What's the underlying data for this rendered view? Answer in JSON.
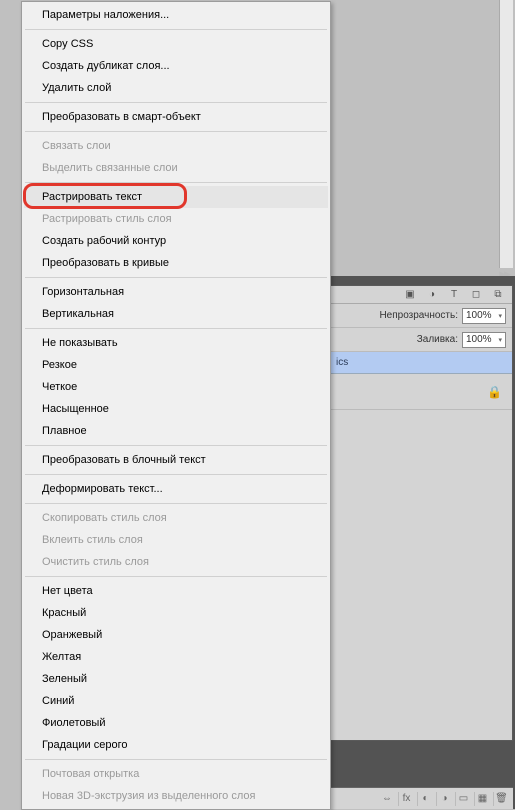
{
  "tab_arrows": "▶▶",
  "panel": {
    "opacity_label": "Непрозрачность:",
    "opacity_value": "100%",
    "fill_label": "Заливка:",
    "fill_value": "100%",
    "layer_name": "ics",
    "tab_icons": [
      "image",
      "circle",
      "text",
      "rect",
      "copy"
    ],
    "footer_icons": [
      "link",
      "fx",
      "mask",
      "adjust",
      "folder",
      "new",
      "trash"
    ]
  },
  "menu": {
    "items": [
      {
        "label": "Параметры наложения...",
        "enabled": true
      },
      {
        "sep": true
      },
      {
        "label": "Copy CSS",
        "enabled": true
      },
      {
        "label": "Создать дубликат слоя...",
        "enabled": true
      },
      {
        "label": "Удалить слой",
        "enabled": true
      },
      {
        "sep": true
      },
      {
        "label": "Преобразовать в смарт-объект",
        "enabled": true
      },
      {
        "sep": true
      },
      {
        "label": "Связать слои",
        "enabled": false
      },
      {
        "label": "Выделить связанные слои",
        "enabled": false
      },
      {
        "sep": true
      },
      {
        "label": "Растрировать текст",
        "enabled": true,
        "highlight": true,
        "focus": true
      },
      {
        "label": "Растрировать стиль слоя",
        "enabled": false
      },
      {
        "label": "Создать рабочий контур",
        "enabled": true
      },
      {
        "label": "Преобразовать в кривые",
        "enabled": true
      },
      {
        "sep": true
      },
      {
        "label": "Горизонтальная",
        "enabled": true
      },
      {
        "label": "Вертикальная",
        "enabled": true
      },
      {
        "sep": true
      },
      {
        "label": "Не показывать",
        "enabled": true
      },
      {
        "label": "Резкое",
        "enabled": true
      },
      {
        "label": "Четкое",
        "enabled": true
      },
      {
        "label": "Насыщенное",
        "enabled": true
      },
      {
        "label": "Плавное",
        "enabled": true
      },
      {
        "sep": true
      },
      {
        "label": "Преобразовать в блочный текст",
        "enabled": true
      },
      {
        "sep": true
      },
      {
        "label": "Деформировать текст...",
        "enabled": true
      },
      {
        "sep": true
      },
      {
        "label": "Скопировать стиль слоя",
        "enabled": false
      },
      {
        "label": "Вклеить стиль слоя",
        "enabled": false
      },
      {
        "label": "Очистить стиль слоя",
        "enabled": false
      },
      {
        "sep": true
      },
      {
        "label": "Нет цвета",
        "enabled": true
      },
      {
        "label": "Красный",
        "enabled": true
      },
      {
        "label": "Оранжевый",
        "enabled": true
      },
      {
        "label": "Желтая",
        "enabled": true
      },
      {
        "label": "Зеленый",
        "enabled": true
      },
      {
        "label": "Синий",
        "enabled": true
      },
      {
        "label": "Фиолетовый",
        "enabled": true
      },
      {
        "label": "Градации серого",
        "enabled": true
      },
      {
        "sep": true
      },
      {
        "label": "Почтовая открытка",
        "enabled": false
      },
      {
        "label": "Новая 3D-экструзия из выделенного слоя",
        "enabled": false
      }
    ]
  }
}
